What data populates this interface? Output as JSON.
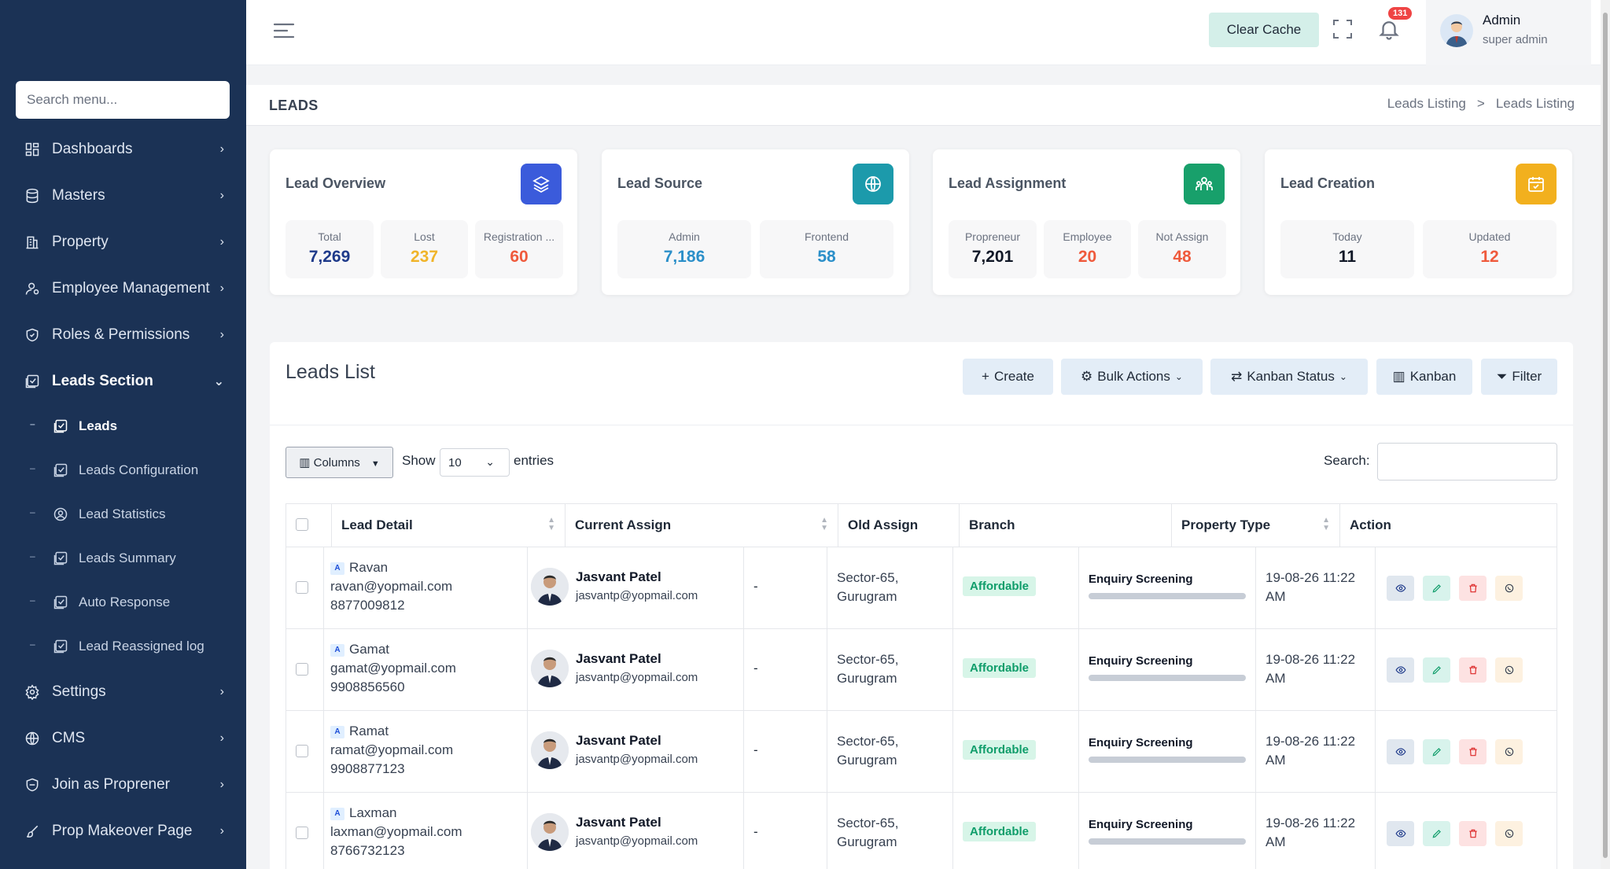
{
  "sidebar": {
    "search_placeholder": "Search menu...",
    "items": [
      {
        "label": "Dashboards",
        "icon": "grid-icon"
      },
      {
        "label": "Masters",
        "icon": "database-icon"
      },
      {
        "label": "Property",
        "icon": "building-icon"
      },
      {
        "label": "Employee Management",
        "icon": "user-icon"
      },
      {
        "label": "Roles & Permissions",
        "icon": "shield-icon"
      },
      {
        "label": "Leads Section",
        "icon": "checklist-icon"
      }
    ],
    "sub_items": [
      {
        "label": "Leads"
      },
      {
        "label": "Leads Configuration"
      },
      {
        "label": "Lead Statistics"
      },
      {
        "label": "Leads Summary"
      },
      {
        "label": "Auto Response"
      },
      {
        "label": "Lead Reassigned log"
      }
    ],
    "bottom_items": [
      {
        "label": "Settings"
      },
      {
        "label": "CMS"
      },
      {
        "label": "Join as Proprener"
      },
      {
        "label": "Prop Makeover Page"
      }
    ]
  },
  "topbar": {
    "clear_cache": "Clear Cache",
    "notification_count": "131",
    "user_name": "Admin",
    "user_role": "super admin"
  },
  "page": {
    "title": "LEADS",
    "breadcrumb": [
      "Leads Listing",
      ">",
      "Leads Listing"
    ]
  },
  "cards": [
    {
      "title": "Lead Overview",
      "icon_color": "#3b5bdb",
      "stats": [
        {
          "label": "Total",
          "value": "7,269",
          "color": "#1e3a8a"
        },
        {
          "label": "Lost",
          "value": "237",
          "color": "#f0b429"
        },
        {
          "label": "Registration ...",
          "value": "60",
          "color": "#ef5a3c"
        }
      ]
    },
    {
      "title": "Lead Source",
      "icon_color": "#1c9aab",
      "stats": [
        {
          "label": "Admin",
          "value": "7,186",
          "color": "#2b8fc9"
        },
        {
          "label": "Frontend",
          "value": "58",
          "color": "#2b8fc9"
        }
      ]
    },
    {
      "title": "Lead Assignment",
      "icon_color": "#18a06b",
      "stats": [
        {
          "label": "Propreneur",
          "value": "7,201",
          "color": "#111827"
        },
        {
          "label": "Employee",
          "value": "20",
          "color": "#ef5a3c"
        },
        {
          "label": "Not Assign",
          "value": "48",
          "color": "#ef5a3c"
        }
      ]
    },
    {
      "title": "Lead Creation",
      "icon_color": "#f2b01e",
      "stats": [
        {
          "label": "Today",
          "value": "11",
          "color": "#111827"
        },
        {
          "label": "Updated",
          "value": "12",
          "color": "#ef5a3c"
        }
      ]
    }
  ],
  "list": {
    "title": "Leads List",
    "buttons": {
      "create": "Create",
      "bulk": "Bulk Actions",
      "kanban_status": "Kanban Status",
      "kanban": "Kanban",
      "filter": "Filter"
    },
    "columns_btn": "Columns",
    "show": "Show",
    "entries_value": "10",
    "entries": "entries",
    "search": "Search:",
    "headers": [
      "Lead Detail",
      "Current Assign",
      "Old Assign",
      "Branch",
      "Property Type",
      "Action"
    ],
    "rows": [
      {
        "name": "Ravan",
        "email": "ravan@yopmail.com",
        "phone": "8877009812",
        "assignee": "Jasvant Patel",
        "assignee_email": "jasvantp@yopmail.com",
        "old_assign": "-",
        "branch_line1": "Sector-65,",
        "branch_line2": "Gurugram",
        "property_type": "Affordable",
        "status": "Enquiry Screening",
        "date_line1": "19-08-26 11:22",
        "date_line2": "AM"
      },
      {
        "name": "Gamat",
        "email": "gamat@yopmail.com",
        "phone": "9908856560",
        "assignee": "Jasvant Patel",
        "assignee_email": "jasvantp@yopmail.com",
        "old_assign": "-",
        "branch_line1": "Sector-65,",
        "branch_line2": "Gurugram",
        "property_type": "Affordable",
        "status": "Enquiry Screening",
        "date_line1": "19-08-26 11:22",
        "date_line2": "AM"
      },
      {
        "name": "Ramat",
        "email": "ramat@yopmail.com",
        "phone": "9908877123",
        "assignee": "Jasvant Patel",
        "assignee_email": "jasvantp@yopmail.com",
        "old_assign": "-",
        "branch_line1": "Sector-65,",
        "branch_line2": "Gurugram",
        "property_type": "Affordable",
        "status": "Enquiry Screening",
        "date_line1": "19-08-26 11:22",
        "date_line2": "AM"
      },
      {
        "name": "Laxman",
        "email": "laxman@yopmail.com",
        "phone": "8766732123",
        "assignee": "Jasvant Patel",
        "assignee_email": "jasvantp@yopmail.com",
        "old_assign": "-",
        "branch_line1": "Sector-65,",
        "branch_line2": "Gurugram",
        "property_type": "Affordable",
        "status": "Enquiry Screening",
        "date_line1": "19-08-26 11:22",
        "date_line2": "AM"
      }
    ]
  }
}
